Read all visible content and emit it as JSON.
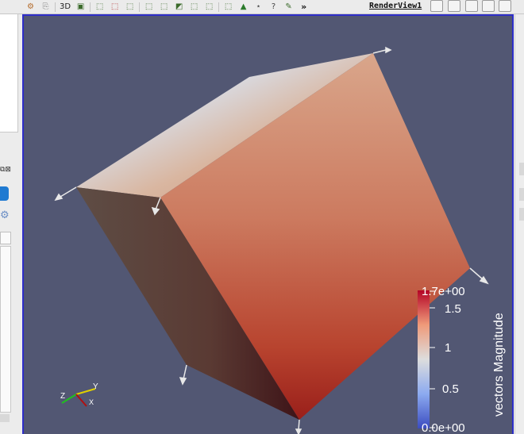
{
  "toolbar": {
    "label_3d": "3D",
    "more": "»",
    "icons": [
      "camera-reset-icon",
      "camera-undo-icon",
      "view-3d-icon",
      "camera-redo-icon",
      "select-cells-icon",
      "select-points-icon",
      "select-frustum-icon",
      "select-block-icon",
      "interactive-select-icon",
      "hover-points-icon",
      "hover-cells-icon",
      "select-polygon-icon",
      "grow-selection-icon",
      "shrink-selection-icon",
      "find-data-icon",
      "query-icon",
      "clear-selection-icon"
    ]
  },
  "render_view": {
    "title": "RenderView1",
    "background": "#525773",
    "layout_buttons": [
      "split-horizontal",
      "split-vertical",
      "maximize",
      "restore",
      "close"
    ]
  },
  "orientation_axes": {
    "y": "Y",
    "z": "Z",
    "x": "X"
  },
  "color_legend": {
    "title": "vectors Magnitude",
    "labels": [
      "1.7e+00",
      "1.5",
      "1",
      "0.5",
      "0.0e+00"
    ],
    "colors": {
      "low": "#3b4cc0",
      "mid": "#dddddd",
      "high": "#b40426"
    }
  }
}
